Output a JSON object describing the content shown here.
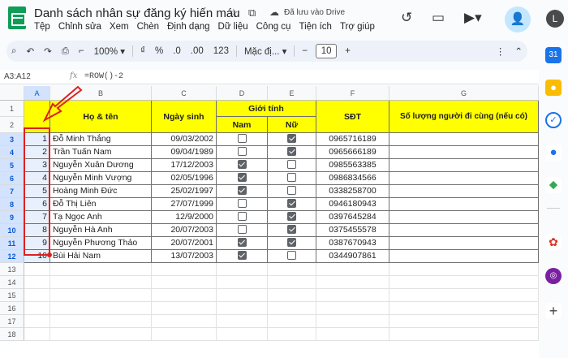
{
  "header": {
    "title": "Danh sách nhân sự đăng ký hiến máu",
    "drive_status": "Đã lưu vào Drive",
    "avatar_letter": "L",
    "star_icon": "star-icon",
    "folder_icon": "move-folder-icon"
  },
  "menu": [
    "Tệp",
    "Chỉnh sửa",
    "Xem",
    "Chèn",
    "Định dạng",
    "Dữ liệu",
    "Công cụ",
    "Tiện ích",
    "Trợ giúp"
  ],
  "toolbar": {
    "zoom": "100%",
    "currency": "₫",
    "percent": "%",
    "dec_less": ".0",
    "dec_more": ".00",
    "number_format": "123",
    "font": "Mặc đị...",
    "font_size": "10",
    "minus": "−",
    "plus": "+"
  },
  "formula_bar": {
    "name_box": "A3:A12",
    "fx": "fx",
    "formula": "=ROW()-2"
  },
  "columns": [
    "A",
    "B",
    "C",
    "D",
    "E",
    "F",
    "G"
  ],
  "rows": [
    "1",
    "2",
    "3",
    "4",
    "5",
    "6",
    "7",
    "8",
    "9",
    "10",
    "11",
    "12",
    "13",
    "14",
    "15",
    "16",
    "17",
    "18"
  ],
  "table": {
    "headers": {
      "name": "Họ & tên",
      "dob": "Ngày sinh",
      "gender": "Giới tính",
      "male": "Nam",
      "female": "Nữ",
      "phone": "SĐT",
      "companions": "Số lượng người đi cùng (nếu có)"
    },
    "records": [
      {
        "stt": "1",
        "name": "Đỗ Minh Thắng",
        "dob": "09/03/2002",
        "male": false,
        "female": true,
        "phone": "0965716189"
      },
      {
        "stt": "2",
        "name": "Trần Tuấn Nam",
        "dob": "09/04/1989",
        "male": false,
        "female": true,
        "phone": "0965666189"
      },
      {
        "stt": "3",
        "name": "Nguyễn Xuân Dương",
        "dob": "17/12/2003",
        "male": true,
        "female": false,
        "phone": "0985563385"
      },
      {
        "stt": "4",
        "name": "Nguyễn Minh Vượng",
        "dob": "02/05/1996",
        "male": true,
        "female": false,
        "phone": "0986834566"
      },
      {
        "stt": "5",
        "name": "Hoàng Minh Đức",
        "dob": "25/02/1997",
        "male": true,
        "female": false,
        "phone": "0338258700"
      },
      {
        "stt": "6",
        "name": "Đỗ Thị Liên",
        "dob": "27/07/1999",
        "male": false,
        "female": true,
        "phone": "0946180943"
      },
      {
        "stt": "7",
        "name": "Tạ Ngọc Anh",
        "dob": "12/9/2000",
        "male": false,
        "female": true,
        "phone": "0397645284"
      },
      {
        "stt": "8",
        "name": "Nguyễn Hà Anh",
        "dob": "20/07/2003",
        "male": false,
        "female": true,
        "phone": "0375455578"
      },
      {
        "stt": "9",
        "name": "Nguyễn Phương Thảo",
        "dob": "20/07/2001",
        "male": true,
        "female": true,
        "phone": "0387670943"
      },
      {
        "stt": "10",
        "name": "Bùi Hải Nam",
        "dob": "13/07/2003",
        "male": true,
        "female": false,
        "phone": "0344907861"
      }
    ]
  },
  "annotation": {
    "color": "#e02020",
    "arrow_icon": "red-arrow-icon"
  },
  "side_panel": [
    "calendar-icon",
    "keep-icon",
    "tasks-icon",
    "contacts-icon",
    "maps-icon",
    "apps-script-icon",
    "extension-icon",
    "add-icon"
  ]
}
